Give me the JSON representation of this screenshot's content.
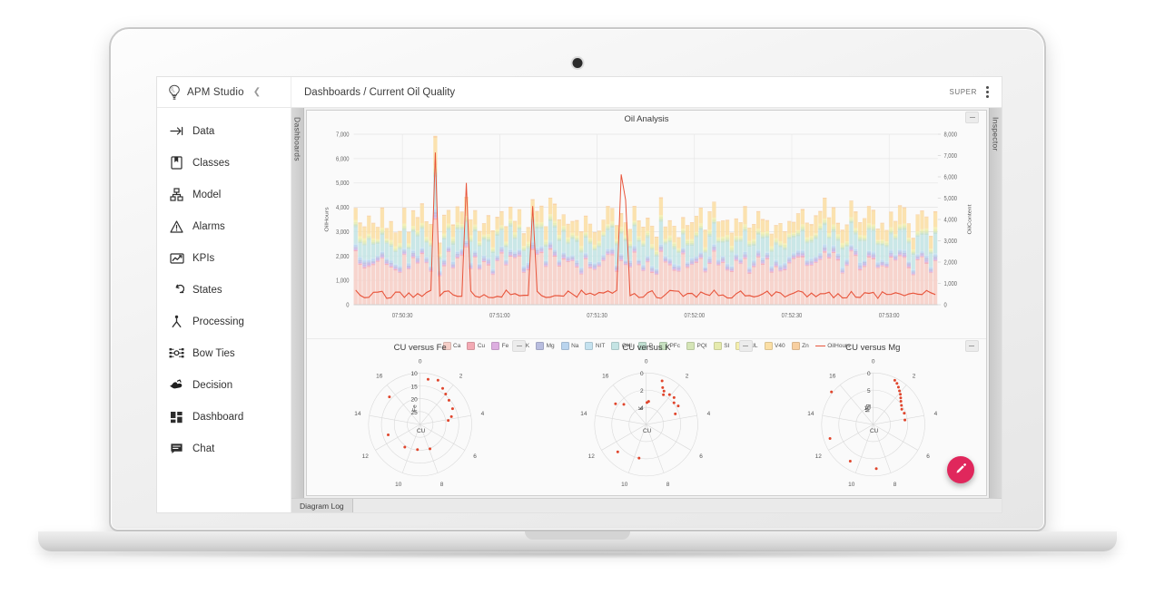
{
  "app": {
    "brand": "APM Studio",
    "brand_logo_icon": "brain-lightbulb-icon",
    "collapse_icon": "chevron-left-icon",
    "breadcrumb": "Dashboards / Current Oil Quality",
    "user": "SUPER",
    "menu_icon": "kebab-menu-icon",
    "fab_icon": "pencil-edit-icon",
    "fab_color": "#e0275c"
  },
  "sidebar": {
    "items": [
      {
        "label": "Data",
        "icon": "data-arrow-icon"
      },
      {
        "label": "Classes",
        "icon": "bookmark-icon"
      },
      {
        "label": "Model",
        "icon": "hierarchy-icon"
      },
      {
        "label": "Alarms",
        "icon": "warning-triangle-icon"
      },
      {
        "label": "KPIs",
        "icon": "chart-line-icon"
      },
      {
        "label": "States",
        "icon": "loop-arrow-icon"
      },
      {
        "label": "Processing",
        "icon": "process-node-icon"
      },
      {
        "label": "Bow Ties",
        "icon": "bowtie-icon"
      },
      {
        "label": "Decision",
        "icon": "decision-hands-icon"
      },
      {
        "label": "Dashboard",
        "icon": "grid-tiles-icon"
      },
      {
        "label": "Chat",
        "icon": "chat-bubble-icon"
      }
    ]
  },
  "side_tabs": {
    "left": "Dashboards",
    "right": "Inspector"
  },
  "bottom": {
    "diagram_log": "Diagram Log"
  },
  "panels": {
    "minimize_label": "minimize",
    "minimize_icon": "minimize-icon"
  },
  "chart_data": [
    {
      "type": "bar",
      "title": "Oil Analysis",
      "xlabel": "",
      "ylabel": "OilHours",
      "y2label": "OilContent",
      "ylim": [
        0,
        7000
      ],
      "y2lim": [
        0,
        8000
      ],
      "yticks": [
        "0",
        "1,000",
        "2,000",
        "3,000",
        "4,000",
        "5,000",
        "6,000",
        "7,000"
      ],
      "y2ticks": [
        "0",
        "1,000",
        "2,000",
        "3,000",
        "4,000",
        "5,000",
        "6,000",
        "7,000",
        "8,000"
      ],
      "xticks": [
        "07:50:30",
        "07:51:00",
        "07:51:30",
        "07:52:00",
        "07:52:30",
        "07:53:00"
      ],
      "grid": true,
      "legend_position": "bottom",
      "stacked": true,
      "series": [
        {
          "name": "Ca",
          "color": "#f6cfc8"
        },
        {
          "name": "Cu",
          "color": "#f3aab4"
        },
        {
          "name": "Fe",
          "color": "#ddaee0"
        },
        {
          "name": "K",
          "color": "#c3b6e3"
        },
        {
          "name": "Mg",
          "color": "#b8bddf"
        },
        {
          "name": "Na",
          "color": "#b9d4ee"
        },
        {
          "name": "NIT",
          "color": "#c5e2ef"
        },
        {
          "name": "OXI",
          "color": "#c4e4e4"
        },
        {
          "name": "P",
          "color": "#bfded0"
        },
        {
          "name": "PFc",
          "color": "#c6e0c0"
        },
        {
          "name": "PQI",
          "color": "#d5e5b7"
        },
        {
          "name": "SI",
          "color": "#e6ebae"
        },
        {
          "name": "SUL",
          "color": "#f4eeae"
        },
        {
          "name": "V40",
          "color": "#fbdfa6"
        },
        {
          "name": "Zn",
          "color": "#f8cfa0"
        }
      ],
      "overlay_line": {
        "name": "OilHours",
        "color": "#e8553c"
      }
    },
    {
      "type": "scatter",
      "subtype": "polar",
      "title": "CU versus Fe",
      "center_label": "CU",
      "angular_ticks": [
        "0",
        "2",
        "4",
        "6",
        "8",
        "10",
        "12",
        "14",
        "16"
      ],
      "radial_ticks": [
        "10",
        "15",
        "20",
        "25"
      ],
      "point_color": "#e0452c",
      "points": [
        {
          "angle": 0.5,
          "radius": 22.8
        },
        {
          "angle": 1.1,
          "radius": 23.5
        },
        {
          "angle": 1.6,
          "radius": 21.5
        },
        {
          "angle": 2.0,
          "radius": 20.4
        },
        {
          "angle": 2.5,
          "radius": 19.6
        },
        {
          "angle": 3.2,
          "radius": 19.0
        },
        {
          "angle": 3.8,
          "radius": 17.5
        },
        {
          "angle": 4.1,
          "radius": 16.0
        },
        {
          "angle": 7.9,
          "radius": 15.2
        },
        {
          "angle": 9.3,
          "radius": 14.8
        },
        {
          "angle": 10.7,
          "radius": 15.6
        },
        {
          "angle": 12.6,
          "radius": 18.0
        },
        {
          "angle": 15.6,
          "radius": 21.0
        }
      ]
    },
    {
      "type": "scatter",
      "subtype": "polar",
      "title": "CU versus K",
      "center_label": "CU",
      "angular_ticks": [
        "0",
        "2",
        "4",
        "6",
        "8",
        "10",
        "12",
        "14",
        "16"
      ],
      "radial_ticks": [
        "0",
        "2",
        "4"
      ],
      "point_color": "#e0452c",
      "points": [
        {
          "angle": 1.0,
          "radius": 3.4
        },
        {
          "angle": 1.2,
          "radius": 2.7
        },
        {
          "angle": 1.4,
          "radius": 2.4
        },
        {
          "angle": 1.5,
          "radius": 2.0
        },
        {
          "angle": 1.9,
          "radius": 2.4
        },
        {
          "angle": 2.3,
          "radius": 2.5
        },
        {
          "angle": 2.6,
          "radius": 2.1
        },
        {
          "angle": 3.0,
          "radius": 2.3
        },
        {
          "angle": 3.5,
          "radius": 1.6
        },
        {
          "angle": 15.2,
          "radius": 2.3
        },
        {
          "angle": 15.6,
          "radius": 1.5
        },
        {
          "angle": 0.3,
          "radius": 0.7
        },
        {
          "angle": 0.1,
          "radius": 0.55
        },
        {
          "angle": 11.3,
          "radius": 2.6
        },
        {
          "angle": 9.6,
          "radius": 2.0
        }
      ]
    },
    {
      "type": "scatter",
      "subtype": "polar",
      "title": "CU versus Mg",
      "center_label": "CU",
      "angular_ticks": [
        "0",
        "2",
        "4",
        "6",
        "8",
        "10",
        "12",
        "14",
        "16"
      ],
      "radial_ticks": [
        "0",
        "5",
        "10"
      ],
      "point_color": "#e0452c",
      "points": [
        {
          "angle": 1.3,
          "radius": 9.3
        },
        {
          "angle": 1.5,
          "radius": 8.8
        },
        {
          "angle": 1.7,
          "radius": 8.1
        },
        {
          "angle": 1.9,
          "radius": 7.4
        },
        {
          "angle": 2.1,
          "radius": 6.8
        },
        {
          "angle": 2.3,
          "radius": 6.1
        },
        {
          "angle": 2.5,
          "radius": 5.5
        },
        {
          "angle": 2.8,
          "radius": 4.9
        },
        {
          "angle": 3.1,
          "radius": 4.4
        },
        {
          "angle": 3.5,
          "radius": 4.6
        },
        {
          "angle": 4.1,
          "radius": 4.3
        },
        {
          "angle": 15.4,
          "radius": 10.4
        },
        {
          "angle": 12.6,
          "radius": 8.2
        },
        {
          "angle": 10.6,
          "radius": 7.6
        },
        {
          "angle": 8.8,
          "radius": 7.9
        }
      ]
    }
  ]
}
